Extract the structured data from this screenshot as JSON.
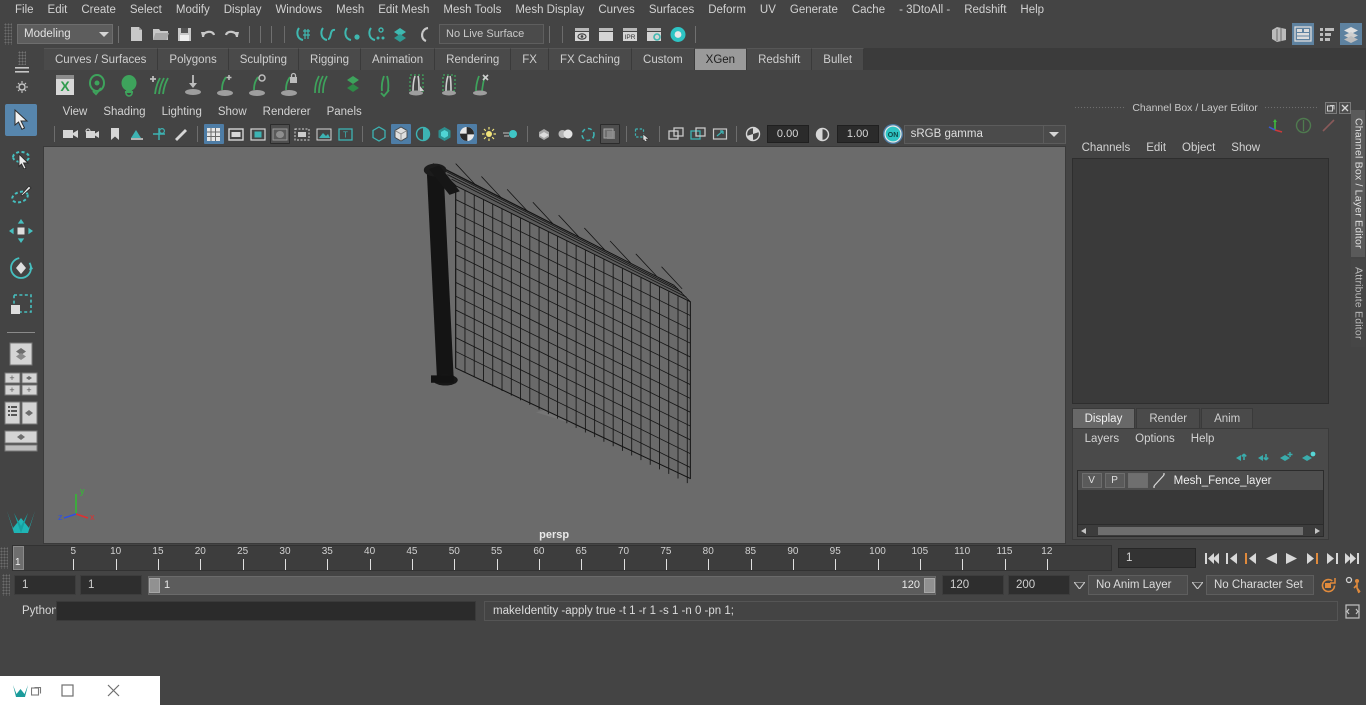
{
  "menubar": {
    "items": [
      "File",
      "Edit",
      "Create",
      "Select",
      "Modify",
      "Display",
      "Windows",
      "Mesh",
      "Edit Mesh",
      "Mesh Tools",
      "Mesh Display",
      "Curves",
      "Surfaces",
      "Deform",
      "UV",
      "Generate",
      "Cache",
      "- 3DtoAll -",
      "Redshift",
      "Help"
    ]
  },
  "statusline": {
    "menuset": "Modeling",
    "live_surface": "No Live Surface",
    "icons": [
      "new-scene-icon",
      "open-scene-icon",
      "save-scene-icon",
      "undo-icon",
      "redo-icon",
      "select-by-hierarchy-icon",
      "select-by-object-icon",
      "select-by-component-icon",
      "snap-to-grid-icon",
      "snap-to-curve-icon",
      "snap-to-point-icon",
      "snap-to-projected-center-icon",
      "snap-to-view-plane-icon",
      "make-live-icon",
      "render-current-frame-icon",
      "render-region-icon",
      "ipr-render-icon",
      "render-settings-icon",
      "hypershade-icon"
    ],
    "workspace_icons": [
      "toggle-model-panel-icon",
      "toggle-attribute-editor-icon",
      "toggle-tool-settings-icon",
      "toggle-channel-box-icon"
    ]
  },
  "shelf": {
    "tabs": [
      "Curves / Surfaces",
      "Polygons",
      "Sculpting",
      "Rigging",
      "Animation",
      "Rendering",
      "FX",
      "FX Caching",
      "Custom",
      "XGen",
      "Redshift",
      "Bullet"
    ],
    "active_tab": "XGen",
    "icons": [
      "xgen-editor-icon",
      "create-description-icon",
      "preview-refresh-icon",
      "add-grooming-icon",
      "place-guide-icon",
      "add-or-move-guide-icon",
      "sculpt-guide-icon",
      "lock-guide-icon",
      "comb-guide-icon",
      "density-brush-icon",
      "part-brush-icon",
      "clump-brush-icon",
      "noise-brush-icon",
      "cut-brush-icon"
    ]
  },
  "toolbox": {
    "tools": [
      {
        "name": "select-tool",
        "active": true
      },
      {
        "name": "lasso-select-tool",
        "active": false
      },
      {
        "name": "paint-select-tool",
        "active": false
      },
      {
        "name": "move-tool",
        "active": false
      },
      {
        "name": "rotate-tool",
        "active": false
      },
      {
        "name": "scale-tool",
        "active": false
      }
    ],
    "layouts": [
      "single-perspective-layout",
      "four-view-layout",
      "outliner-persp-layout",
      "persp-graph-layout"
    ]
  },
  "viewport": {
    "menus": [
      "View",
      "Shading",
      "Lighting",
      "Show",
      "Renderer",
      "Panels"
    ],
    "camera_label": "persp",
    "exposure": "0.00",
    "gamma": "1.00",
    "color_space": "sRGB gamma",
    "view_gamma_toggle": "ON",
    "axis_gizmo": {
      "x_label": "x",
      "y_label": "y",
      "z_label": "z",
      "x_color": "#e03030",
      "y_color": "#30c030",
      "z_color": "#3050e0"
    },
    "background_color": "#6b6b6b",
    "toolbar_icons": [
      "select-camera-icon",
      "camera-attributes-icon",
      "bookmark-icon",
      "image-plane-icon",
      "2d-pan-zoom-icon",
      "grease-pencil-icon",
      "grid-toggle-icon",
      "film-gate-icon",
      "resolution-gate-icon",
      "gate-mask-icon",
      "film-origin-icon",
      "xray-icon",
      "texture-placement-icon",
      "wireframe-shading-icon",
      "smooth-shading-icon",
      "shaded-wireframe-icon",
      "use-all-lights-icon",
      "shadows-icon",
      "screen-space-ao-icon",
      "motion-blur-icon",
      "multisample-aa-icon",
      "depth-of-field-icon",
      "isolate-select-icon",
      "xray-joints-icon",
      "xray-active-components-icon",
      "exposure-icon",
      "gamma-icon",
      "view-transform-icon"
    ]
  },
  "right_panel": {
    "title": "Channel Box / Layer Editor",
    "window_buttons": [
      "undock-icon",
      "close-icon"
    ],
    "header_icons": [
      "axis-gizmo-icon",
      "show-manipulator-icon",
      "no-manip-icon"
    ],
    "channelbox_menus": [
      "Channels",
      "Edit",
      "Object",
      "Show"
    ],
    "layer_tabs": [
      "Display",
      "Render",
      "Anim"
    ],
    "active_layer_tab": "Display",
    "layer_menus": [
      "Layers",
      "Options",
      "Help"
    ],
    "layer_buttons": [
      "move-layer-up-icon",
      "move-layer-down-icon",
      "create-empty-layer-icon",
      "create-layer-from-selected-icon"
    ],
    "layers": [
      {
        "visibility": "V",
        "playback": "P",
        "color_swatch": "",
        "name": "Mesh_Fence_layer"
      }
    ],
    "vertical_tabs": [
      {
        "label": "Channel Box / Layer Editor",
        "active": true
      },
      {
        "label": "Attribute Editor",
        "active": false
      }
    ]
  },
  "timeslider": {
    "tick_labels": [
      "5",
      "10",
      "15",
      "20",
      "25",
      "30",
      "35",
      "40",
      "45",
      "50",
      "55",
      "60",
      "65",
      "70",
      "75",
      "80",
      "85",
      "90",
      "95",
      "100",
      "105",
      "110",
      "115",
      "12"
    ],
    "current_frame": "1",
    "frame_field": "1",
    "playback_buttons": [
      "go-to-start-icon",
      "step-back-keyframe-icon",
      "step-back-frame-icon",
      "play-backwards-icon",
      "play-forwards-icon",
      "step-forward-frame-icon",
      "step-forward-keyframe-icon",
      "go-to-end-icon"
    ]
  },
  "rangeslider": {
    "anim_start": "1",
    "playback_start": "1",
    "range_start_label": "1",
    "range_end_label": "120",
    "playback_end": "120",
    "anim_end": "200",
    "anim_layer": "No Anim Layer",
    "character_set": "No Character Set",
    "icons": [
      "auto-keyframe-icon",
      "animation-preferences-icon"
    ],
    "accent_color": "#e08a3c"
  },
  "commandline": {
    "language": "Python",
    "input_value": "",
    "result": "makeIdentity -apply true -t 1 -r 1 -s 1 -n 0 -pn 1;",
    "script_editor_icon": "script-editor-icon"
  },
  "taskbar": {
    "items": [
      "maya-app-icon",
      "restore-window-icon",
      "minimize-window-icon",
      "close-window-icon"
    ]
  }
}
